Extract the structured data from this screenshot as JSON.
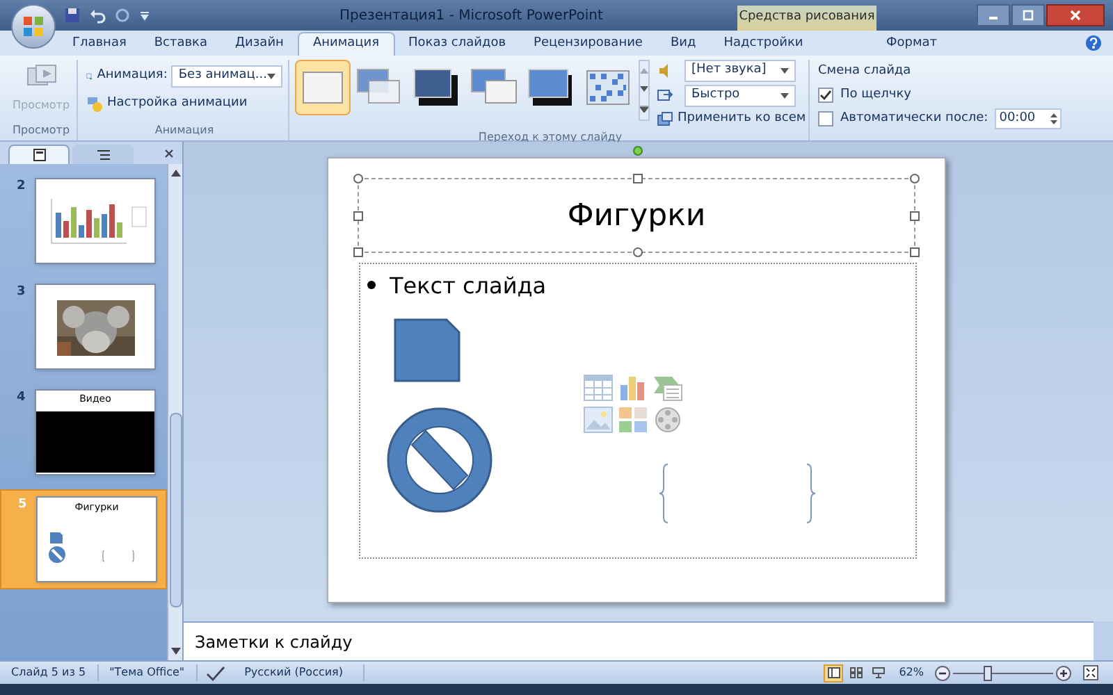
{
  "window": {
    "title": "Презентация1 - Microsoft PowerPoint",
    "context_group": "Средства рисования"
  },
  "tabs": [
    {
      "label": "Главная",
      "selected": false
    },
    {
      "label": "Вставка",
      "selected": false
    },
    {
      "label": "Дизайн",
      "selected": false
    },
    {
      "label": "Анимация",
      "selected": true
    },
    {
      "label": "Показ слайдов",
      "selected": false
    },
    {
      "label": "Рецензирование",
      "selected": false
    },
    {
      "label": "Вид",
      "selected": false
    },
    {
      "label": "Надстройки",
      "selected": false
    },
    {
      "label": "Формат",
      "selected": false
    }
  ],
  "ribbon": {
    "preview": {
      "button": "Просмотр",
      "group_label": "Просмотр",
      "disabled": true
    },
    "animation": {
      "label": "Анимация:",
      "value": "Без анимац...",
      "custom": "Настройка анимации",
      "group_label": "Анимация"
    },
    "transition": {
      "gallery": [
        {
          "kind": "none",
          "selected": true
        },
        {
          "kind": "fade",
          "selected": false
        },
        {
          "kind": "dark",
          "selected": false
        },
        {
          "kind": "push",
          "selected": false
        },
        {
          "kind": "cover",
          "selected": false
        },
        {
          "kind": "dissolve",
          "selected": false
        }
      ],
      "sound": "[Нет звука]",
      "speed": "Быстро",
      "apply_all": "Применить ко всем",
      "group_label": "Переход к этому слайду"
    },
    "advance": {
      "title": "Смена слайда",
      "on_click": {
        "label": "По щелчку",
        "checked": true
      },
      "auto": {
        "label": "Автоматически после:",
        "checked": false,
        "value": "00:00"
      }
    }
  },
  "panel_tabs": [
    {
      "kind": "slides",
      "selected": true
    },
    {
      "kind": "outline",
      "selected": false
    }
  ],
  "slides": [
    {
      "number": "2",
      "kind": "chart",
      "selected": false
    },
    {
      "number": "3",
      "kind": "picture",
      "selected": false
    },
    {
      "number": "4",
      "kind": "video",
      "title": "Видео",
      "selected": false
    },
    {
      "number": "5",
      "kind": "shapes",
      "title": "Фигурки",
      "selected": true
    }
  ],
  "slide": {
    "title": "Фигурки",
    "bullet": "Текст слайда"
  },
  "notes": {
    "text": "Заметки к слайду"
  },
  "status_bar": {
    "slide_info": "Слайд 5 из 5",
    "theme": "\"Тема Office\"",
    "language": "Русский (Россия)",
    "views": [
      {
        "kind": "normal",
        "selected": true
      },
      {
        "kind": "sorter",
        "selected": false
      },
      {
        "kind": "show",
        "selected": false
      }
    ],
    "zoom": "62%",
    "zoom_slider": {
      "level": 0.35
    }
  }
}
